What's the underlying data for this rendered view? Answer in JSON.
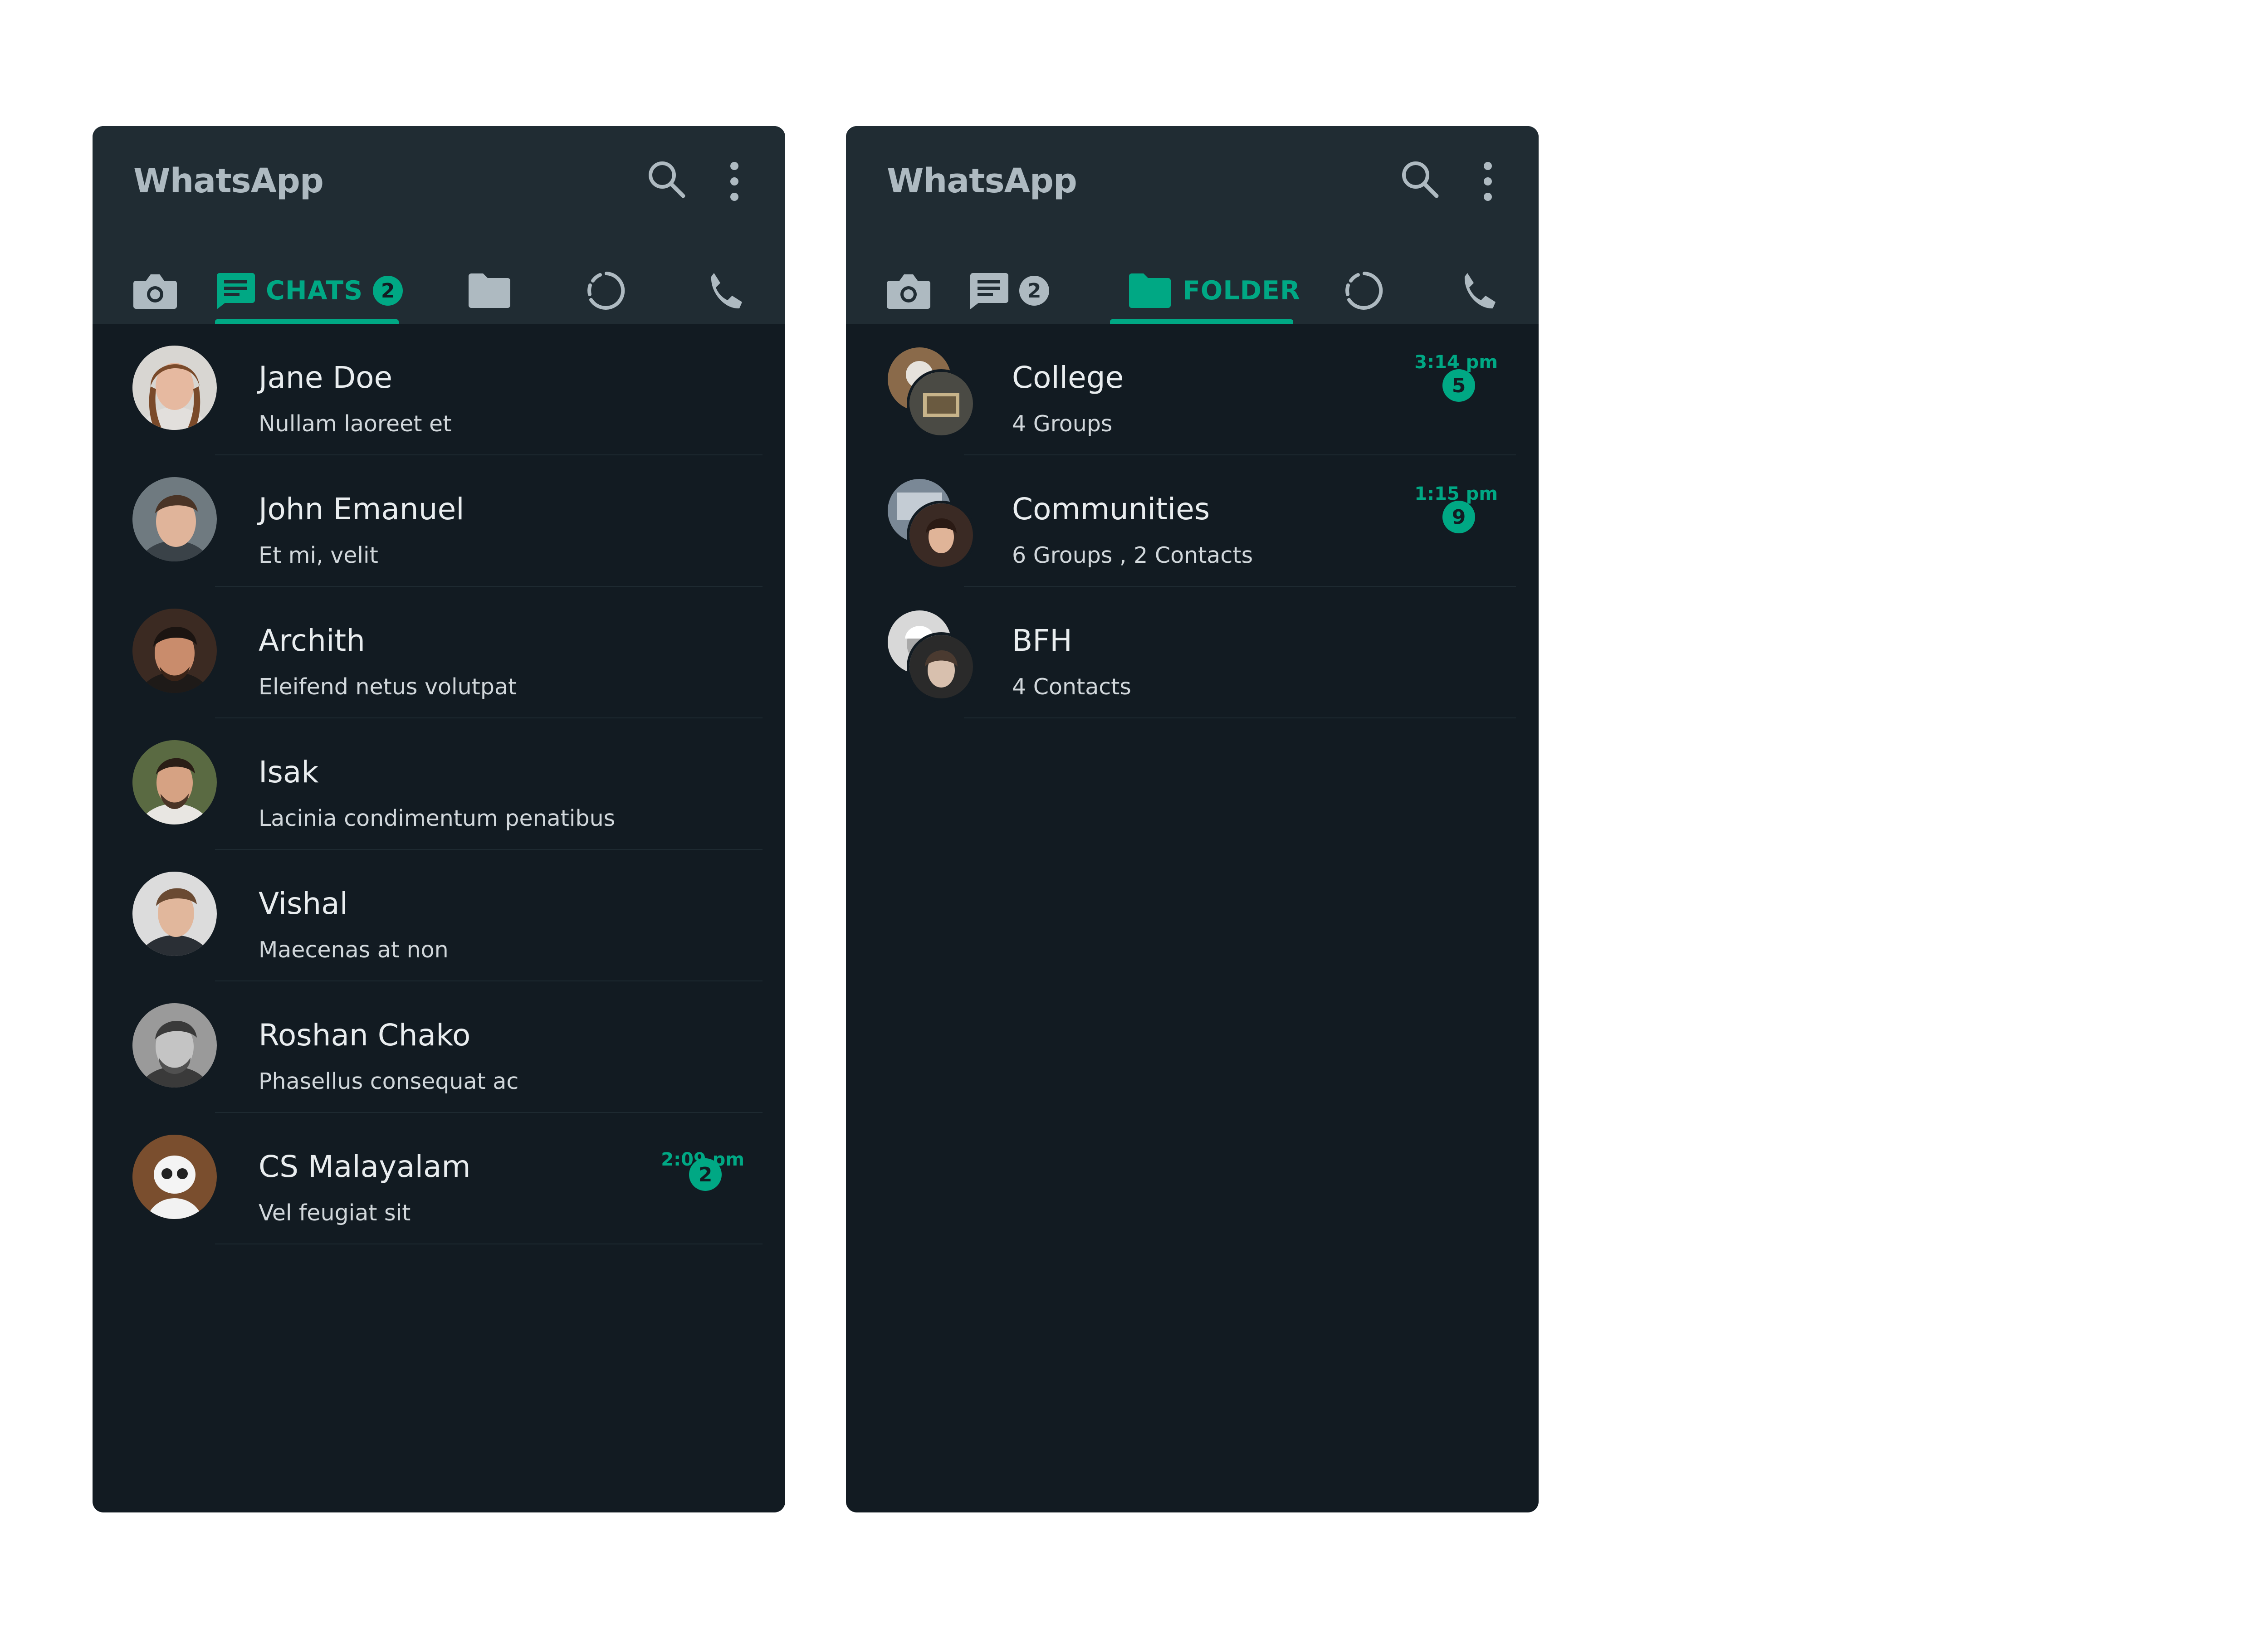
{
  "colors": {
    "accent": "#00a884",
    "header_bg": "#202c33",
    "list_bg": "#121b22",
    "icon_muted": "#aebac1",
    "text_primary": "#e9edef",
    "text_secondary": "#d1d7db"
  },
  "left": {
    "app_title": "WhatsApp",
    "icons": [
      "search-icon",
      "more-vert-icon",
      "camera-icon",
      "chat-icon",
      "folder-icon",
      "status-icon",
      "call-icon"
    ],
    "tabs": {
      "active_label": "CHATS",
      "active_badge": "2"
    },
    "chats": [
      {
        "name": "Jane Doe",
        "preview": "Nullam laoreet et",
        "time": "",
        "unread": ""
      },
      {
        "name": "John Emanuel",
        "preview": "Et mi, velit",
        "time": "",
        "unread": ""
      },
      {
        "name": "Archith",
        "preview": "Eleifend netus volutpat",
        "time": "",
        "unread": ""
      },
      {
        "name": "Isak",
        "preview": "Lacinia condimentum penatibus",
        "time": "",
        "unread": ""
      },
      {
        "name": "Vishal",
        "preview": "Maecenas at non",
        "time": "",
        "unread": ""
      },
      {
        "name": "Roshan Chako",
        "preview": "Phasellus consequat ac",
        "time": "",
        "unread": ""
      },
      {
        "name": "CS Malayalam",
        "preview": "Vel feugiat sit",
        "time": "2:09 pm",
        "unread": "2"
      }
    ]
  },
  "right": {
    "app_title": "WhatsApp",
    "tabs": {
      "chats_badge": "2",
      "active_label": "FOLDER"
    },
    "folders": [
      {
        "name": "College",
        "detail": "4 Groups",
        "time": "3:14 pm",
        "unread": "5"
      },
      {
        "name": "Communities",
        "detail": "6 Groups , 2 Contacts",
        "time": "1:15 pm",
        "unread": "9"
      },
      {
        "name": "BFH",
        "detail": "4 Contacts",
        "time": "",
        "unread": ""
      }
    ]
  }
}
